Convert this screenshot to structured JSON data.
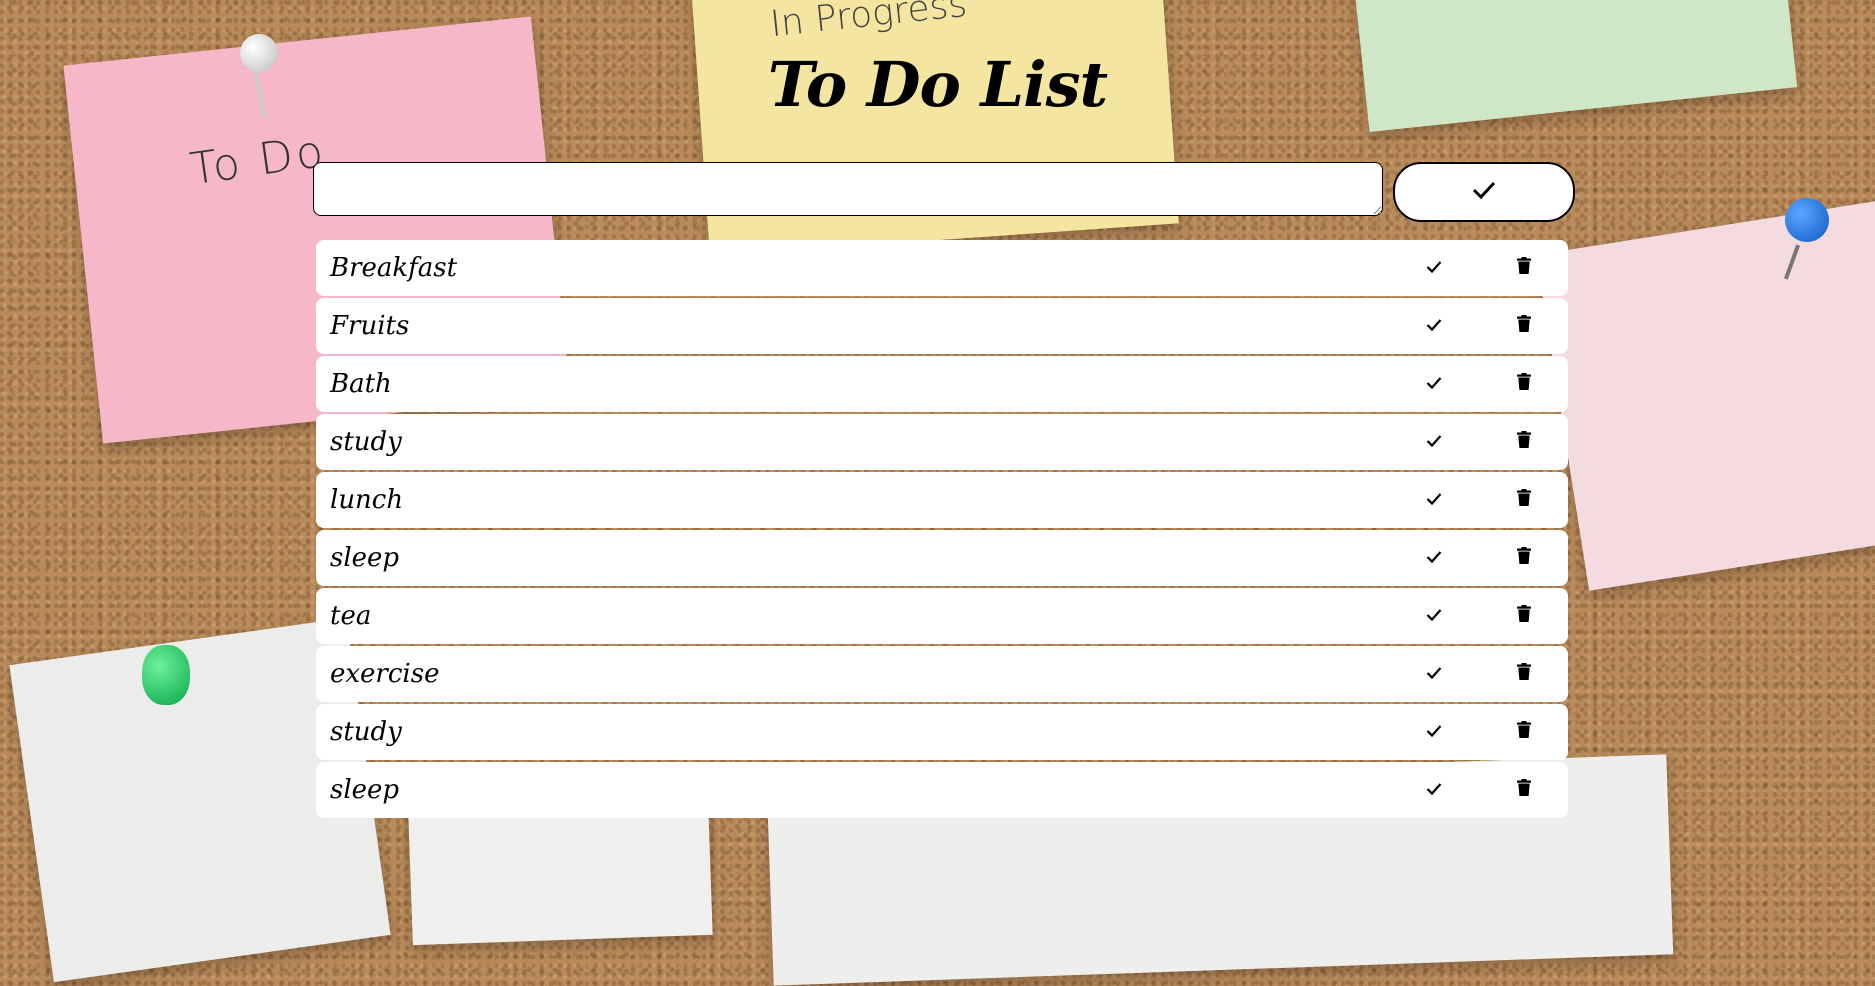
{
  "background": {
    "notes": [
      {
        "text": "To Do"
      },
      {
        "text": "In Progress"
      }
    ]
  },
  "app": {
    "title": "To Do List"
  },
  "input": {
    "value": "",
    "placeholder": ""
  },
  "add_button": {
    "icon": "check-icon"
  },
  "todos": [
    {
      "label": "Breakfast"
    },
    {
      "label": "Fruits"
    },
    {
      "label": "Bath"
    },
    {
      "label": "study"
    },
    {
      "label": "lunch"
    },
    {
      "label": "sleep"
    },
    {
      "label": "tea"
    },
    {
      "label": "exercise"
    },
    {
      "label": "study"
    },
    {
      "label": "sleep"
    }
  ],
  "item_actions": {
    "complete_icon": "check-icon",
    "delete_icon": "trash-icon"
  },
  "colors": {
    "board": "#b98a5a",
    "card": "#ffffff",
    "text": "#000000"
  }
}
